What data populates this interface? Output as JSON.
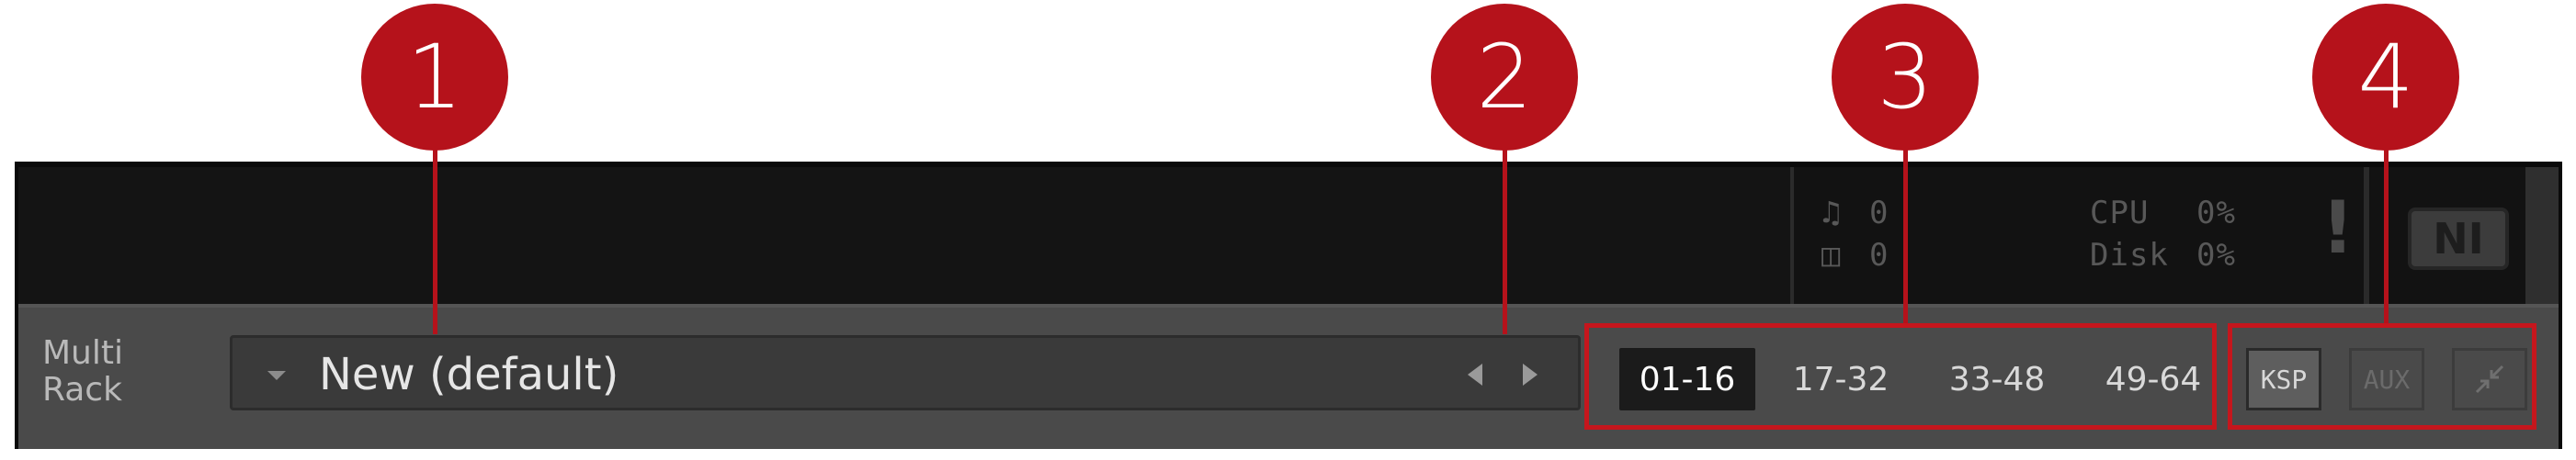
{
  "callouts": [
    "1",
    "2",
    "3",
    "4"
  ],
  "stats": {
    "voices_icon": "note-icon",
    "voices_value": "0",
    "memory_icon": "memory-icon",
    "memory_value": "0",
    "cpu_label": "CPU",
    "cpu_value": "0%",
    "disk_label": "Disk",
    "disk_value": "0%",
    "warning_glyph": "!",
    "logo_text": "NI"
  },
  "rack": {
    "label_line1": "Multi",
    "label_line2": "Rack",
    "preset_name": "New (default)",
    "banks": [
      "01-16",
      "17-32",
      "33-48",
      "49-64"
    ],
    "active_bank": "01-16",
    "tools": {
      "ksp": "KSP",
      "aux": "AUX",
      "minimize_icon": "minimize-arrows-icon"
    }
  },
  "colors": {
    "callout": "#b5121b",
    "highlight_box": "#c5161d"
  }
}
